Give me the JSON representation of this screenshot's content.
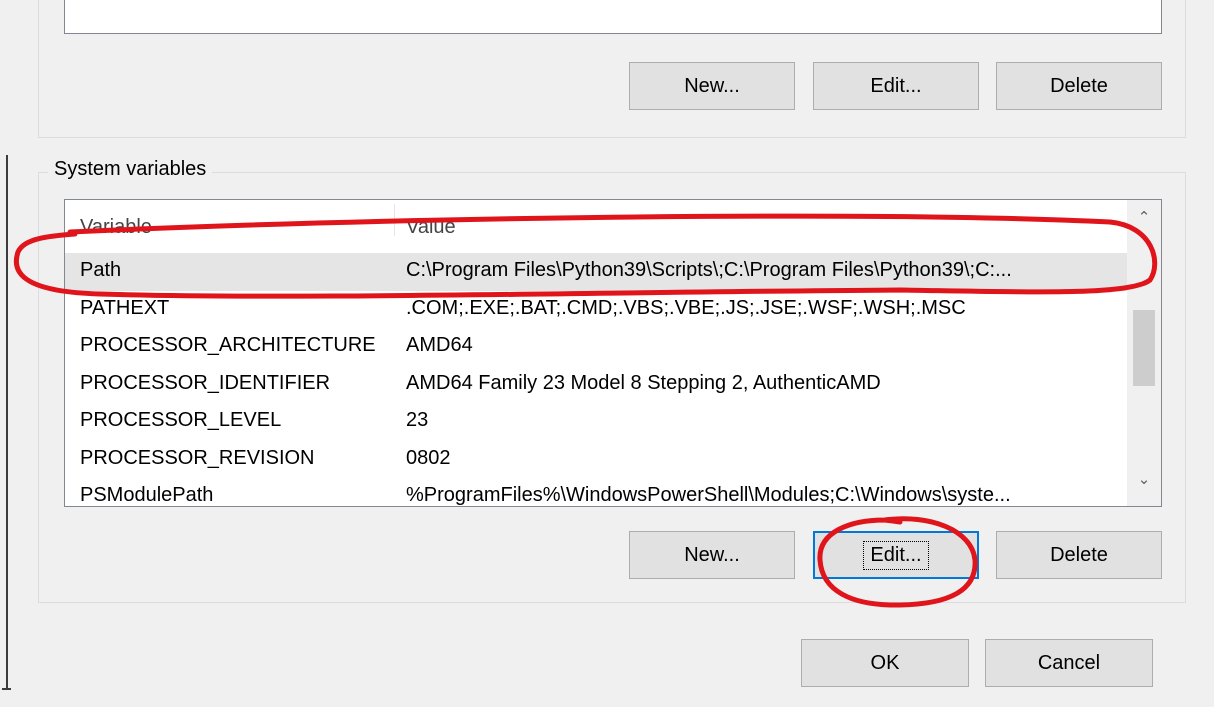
{
  "user_variables": {
    "buttons": {
      "new": "New...",
      "edit": "Edit...",
      "delete": "Delete"
    }
  },
  "system_variables": {
    "group_title": "System variables",
    "columns": {
      "variable": "Variable",
      "value": "Value"
    },
    "rows": [
      {
        "variable": "Path",
        "value": "C:\\Program Files\\Python39\\Scripts\\;C:\\Program Files\\Python39\\;C:...",
        "selected": true
      },
      {
        "variable": "PATHEXT",
        "value": ".COM;.EXE;.BAT;.CMD;.VBS;.VBE;.JS;.JSE;.WSF;.WSH;.MSC"
      },
      {
        "variable": "PROCESSOR_ARCHITECTURE",
        "value": "AMD64"
      },
      {
        "variable": "PROCESSOR_IDENTIFIER",
        "value": "AMD64 Family 23 Model 8 Stepping 2, AuthenticAMD"
      },
      {
        "variable": "PROCESSOR_LEVEL",
        "value": "23"
      },
      {
        "variable": "PROCESSOR_REVISION",
        "value": "0802"
      },
      {
        "variable": "PSModulePath",
        "value": "%ProgramFiles%\\WindowsPowerShell\\Modules;C:\\Windows\\syste..."
      }
    ],
    "buttons": {
      "new": "New...",
      "edit": "Edit...",
      "delete": "Delete"
    }
  },
  "dialog_buttons": {
    "ok": "OK",
    "cancel": "Cancel"
  },
  "annotation_color": "#e0141b",
  "icons": {
    "scroll_up": "chevron-up-icon",
    "scroll_down": "chevron-down-icon"
  }
}
